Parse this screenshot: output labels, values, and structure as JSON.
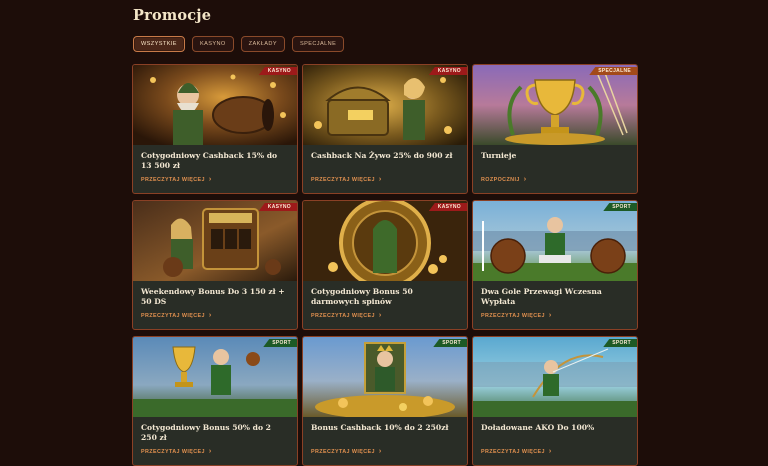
{
  "page": {
    "title": "Promocje"
  },
  "filters": [
    {
      "label": "WSZYSTKIE",
      "active": true
    },
    {
      "label": "KASYNO",
      "active": false
    },
    {
      "label": "ZAKŁADY",
      "active": false
    },
    {
      "label": "SPECJALNE",
      "active": false
    }
  ],
  "cards": [
    {
      "title": "Cotygodniowy Cashback 15% do 13 500 zł",
      "badge": "KASYNO",
      "cta": "PRZECZYTAJ WIĘCEJ",
      "image": "elf-with-barrel-and-coins"
    },
    {
      "title": "Cashback Na Żywo 25% do 900 zł",
      "badge": "KASYNO",
      "cta": "PRZECZYTAJ WIĘCEJ",
      "image": "elf-woman-with-treasure-chest"
    },
    {
      "title": "Turnieje",
      "badge": "SPECJALNE",
      "cta": "ROZPOCZNIJ",
      "image": "golden-trophy"
    },
    {
      "title": "Weekendowy Bonus Do 3 150 zł + 50 DS",
      "badge": "KASYNO",
      "cta": "PRZECZYTAJ WIĘCEJ",
      "image": "elf-woman-at-slot-machine"
    },
    {
      "title": "Cotygodniowy Bonus 50 darmowych spinów",
      "badge": "KASYNO",
      "cta": "PRZECZYTAJ WIĘCEJ",
      "image": "elf-archer-in-golden-wheel"
    },
    {
      "title": "Dwa Gole Przewagi Wczesna Wypłata",
      "badge": "SPORT",
      "cta": "PRZECZYTAJ WIĘCEJ",
      "image": "footballer-with-two-balls"
    },
    {
      "title": "Cotygodniowy Bonus 50% do 2 250 zł",
      "badge": "SPORT",
      "cta": "PRZECZYTAJ WIĘCEJ",
      "image": "player-with-trophy-and-ball"
    },
    {
      "title": "Bonus Cashback 10% do 2 250zł",
      "badge": "SPORT",
      "cta": "PRZECZYTAJ WIĘCEJ",
      "image": "king-on-throne-with-gold"
    },
    {
      "title": "Doładowane AKO Do 100%",
      "badge": "SPORT",
      "cta": "PRZECZYTAJ WIĘCEJ",
      "image": "archer-in-stadium"
    }
  ],
  "colors": {
    "background": "#1d0d09",
    "card": "#292d26",
    "card_border": "#8a4025",
    "cta": "#e0904f",
    "badge_kasyno": "#9d1a1a",
    "badge_specjalne": "#a34a1a",
    "badge_sport": "#1d5a26"
  }
}
